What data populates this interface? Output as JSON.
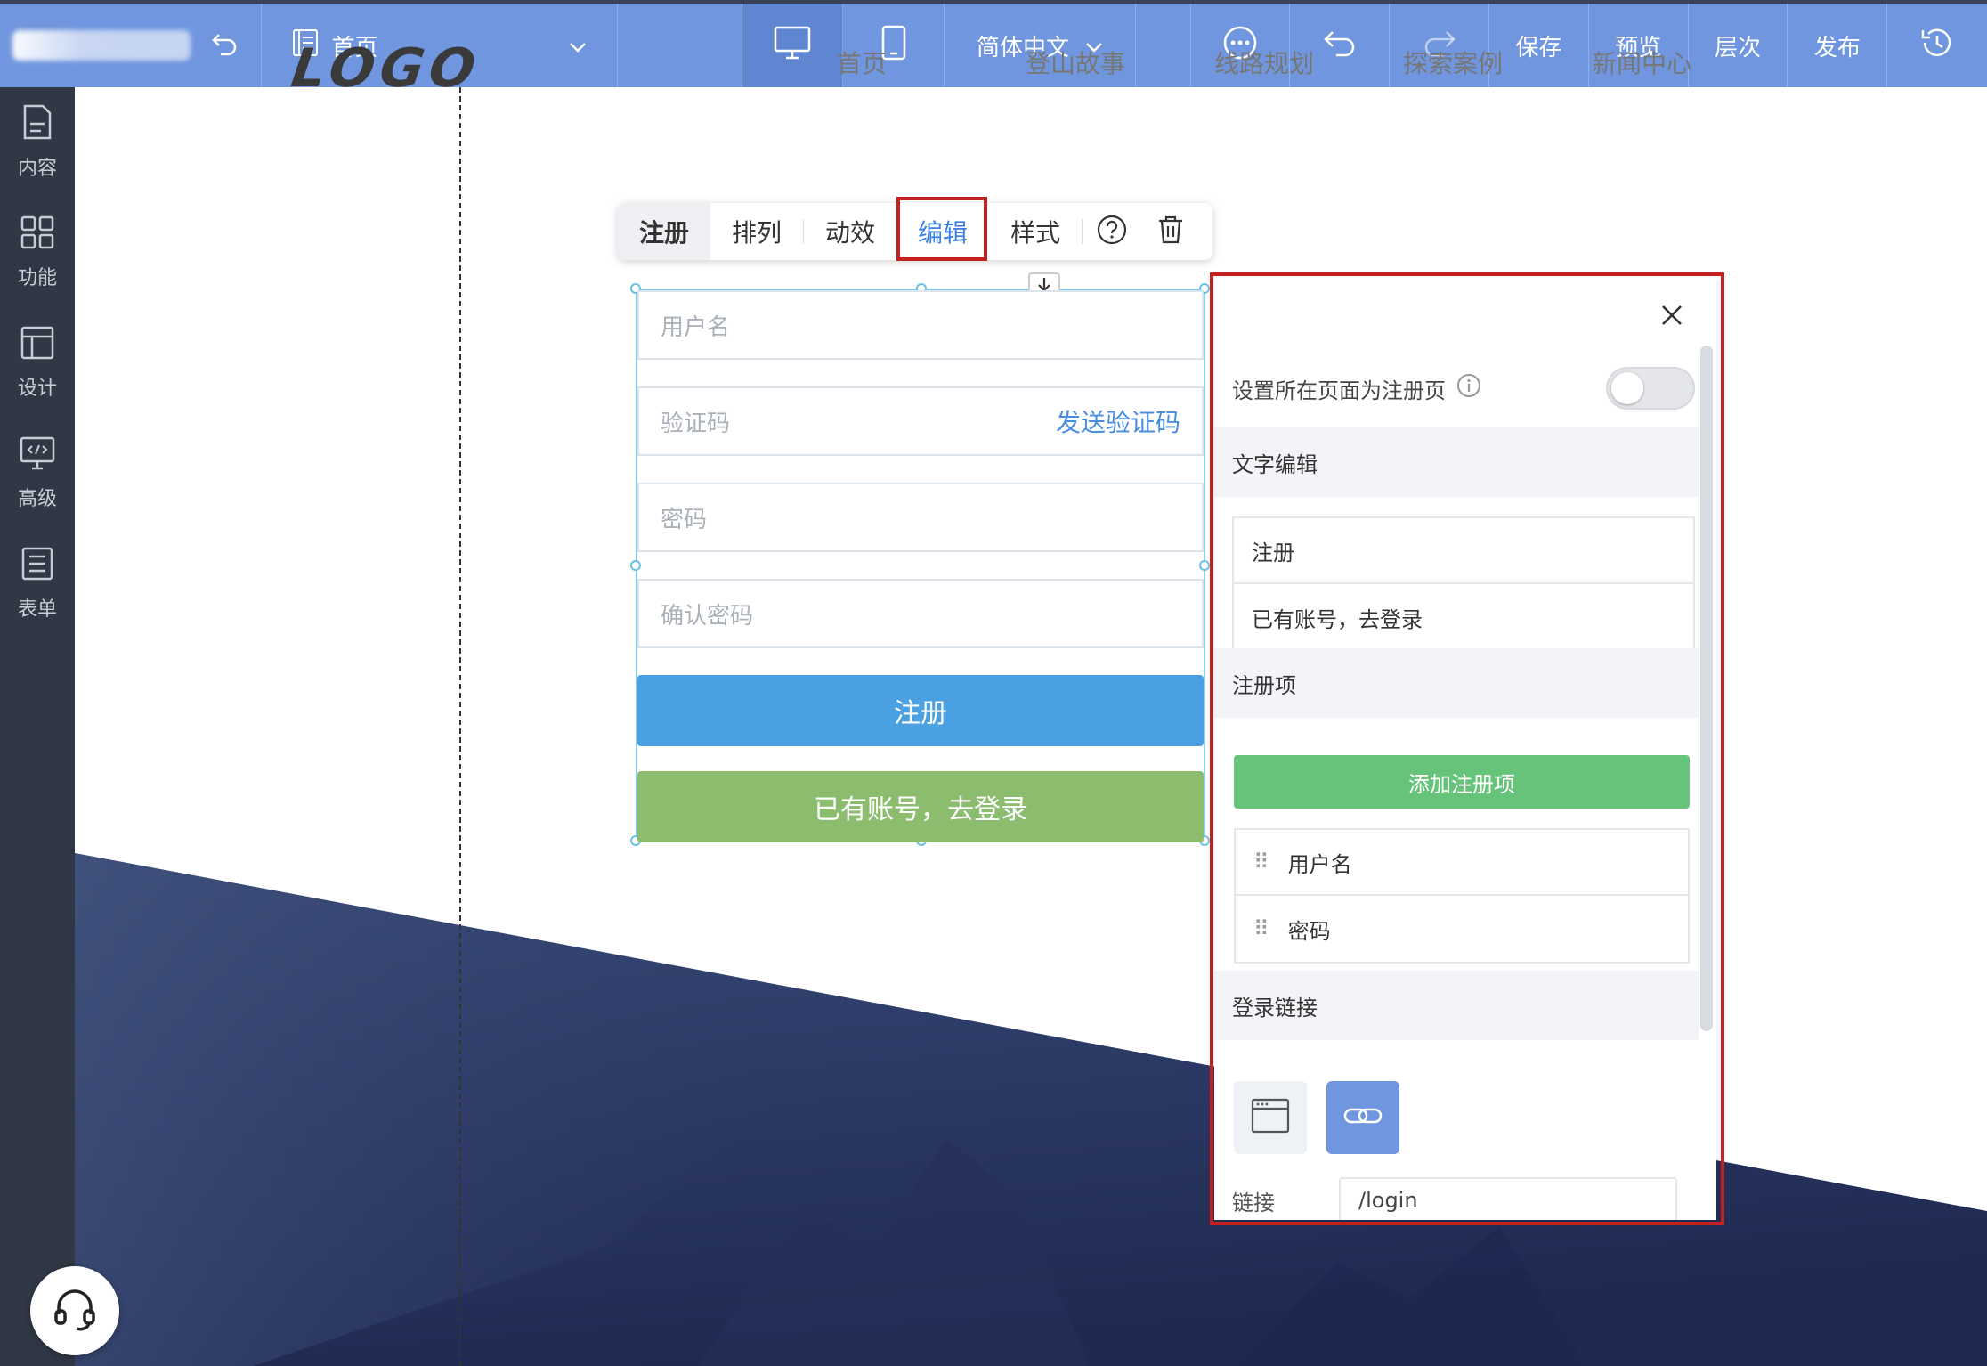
{
  "topbar": {
    "page_selector": "首页",
    "language": "简体中文",
    "save": "保存",
    "preview": "预览",
    "layers": "层次",
    "publish": "发布"
  },
  "sidebar": {
    "items": [
      {
        "label": "内容",
        "icon": "document-icon"
      },
      {
        "label": "功能",
        "icon": "grid-icon"
      },
      {
        "label": "设计",
        "icon": "layout-icon"
      },
      {
        "label": "高级",
        "icon": "code-monitor-icon"
      },
      {
        "label": "表单",
        "icon": "form-list-icon"
      }
    ]
  },
  "site": {
    "logo": "LOGO",
    "nav": [
      "首页",
      "登山故事",
      "线路规划",
      "探索案例",
      "新闻中心"
    ]
  },
  "element_toolbar": {
    "register": "注册",
    "arrange": "排列",
    "animation": "动效",
    "edit": "编辑",
    "style": "样式"
  },
  "form": {
    "username_placeholder": "用户名",
    "code_placeholder": "验证码",
    "send_code": "发送验证码",
    "password_placeholder": "密码",
    "confirm_placeholder": "确认密码",
    "register_button": "注册",
    "login_button": "已有账号，去登录"
  },
  "panel": {
    "set_register_page": "设置所在页面为注册页",
    "text_edit_title": "文字编辑",
    "text_items": [
      "注册",
      "已有账号，去登录"
    ],
    "register_items_title": "注册项",
    "add_item": "添加注册项",
    "register_items": [
      "用户名",
      "密码"
    ],
    "login_link_title": "登录链接",
    "link_label": "链接",
    "link_value": "/login"
  },
  "colors": {
    "topbar": "#6f96de",
    "sidebar": "#303846",
    "primary_button": "#4aa0e0",
    "login_button": "#8cbc6e",
    "add_button": "#66c47a",
    "highlight_box": "#c4201f"
  }
}
